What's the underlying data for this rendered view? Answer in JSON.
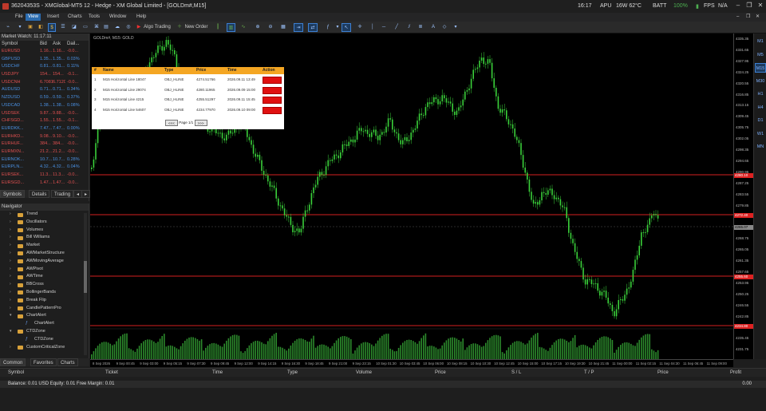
{
  "window": {
    "title": "36204353S - XMGlobal-MT5 12 - Hedge - XM Global Limited - [GOLDm#,M15]",
    "clock": "16:17",
    "cpu_label": "APU",
    "cpu_value": "16W 62°C",
    "batt_label": "BATT",
    "batt_value": "100%",
    "fps_label": "FPS",
    "fps_value": "N/A"
  },
  "menu": [
    "File",
    "View",
    "Insert",
    "Charts",
    "Tools",
    "Window",
    "Help"
  ],
  "toolbar": {
    "algo_label": "Algo Trading",
    "new_order_label": "New Order"
  },
  "market_watch": {
    "title": "Market Watch: 11:17:11",
    "columns": {
      "symbol": "Symbol",
      "bid": "Bid",
      "ask": "Ask",
      "daily": "Dail..."
    },
    "rows": [
      {
        "symbol": "EURUSD",
        "bid": "1.16...",
        "ask": "1.16...",
        "daily": "-0.0...",
        "dir": "neg"
      },
      {
        "symbol": "GBPUSD",
        "bid": "1.35...",
        "ask": "1.35...",
        "daily": "0.03%",
        "dir": "pos"
      },
      {
        "symbol": "USDCHF",
        "bid": "0.81...",
        "ask": "0.81...",
        "daily": "0.11%",
        "dir": "pos"
      },
      {
        "symbol": "USDJPY",
        "bid": "154...",
        "ask": "154...",
        "daily": "-0.1...",
        "dir": "neg"
      },
      {
        "symbol": "USDCNH",
        "bid": "6.7081",
        "ask": "6.7120",
        "daily": "-0.0...",
        "dir": "neg"
      },
      {
        "symbol": "AUDUSD",
        "bid": "0.71...",
        "ask": "0.71...",
        "daily": "0.34%",
        "dir": "pos"
      },
      {
        "symbol": "NZDUSD",
        "bid": "0.59...",
        "ask": "0.59...",
        "daily": "0.37%",
        "dir": "pos"
      },
      {
        "symbol": "USDCAD",
        "bid": "1.38...",
        "ask": "1.38...",
        "daily": "0.08%",
        "dir": "pos"
      },
      {
        "symbol": "USDSEK",
        "bid": "9.87...",
        "ask": "9.88...",
        "daily": "-0.0...",
        "dir": "neg"
      },
      {
        "symbol": "CHFSGD...",
        "bid": "1.55...",
        "ask": "1.55...",
        "daily": "-0.1...",
        "dir": "neg"
      },
      {
        "symbol": "EURDKK...",
        "bid": "7.47...",
        "ask": "7.47...",
        "daily": "0.00%",
        "dir": "pos"
      },
      {
        "symbol": "EURHKD...",
        "bid": "9.08...",
        "ask": "9.10...",
        "daily": "-0.0...",
        "dir": "neg"
      },
      {
        "symbol": "EURHUF...",
        "bid": "384...",
        "ask": "384...",
        "daily": "-0.0...",
        "dir": "neg"
      },
      {
        "symbol": "EURMXN...",
        "bid": "21.2...",
        "ask": "21.2...",
        "daily": "-0.0...",
        "dir": "neg"
      },
      {
        "symbol": "EURNOK...",
        "bid": "10.7...",
        "ask": "10.7...",
        "daily": "0.28%",
        "dir": "pos"
      },
      {
        "symbol": "EURPLN...",
        "bid": "4.32...",
        "ask": "4.32...",
        "daily": "0.04%",
        "dir": "pos"
      },
      {
        "symbol": "EURSEK...",
        "bid": "11.3...",
        "ask": "11.3...",
        "daily": "-0.0...",
        "dir": "neg"
      },
      {
        "symbol": "EURSGD...",
        "bid": "1.47...",
        "ask": "1.47...",
        "daily": "-0.0...",
        "dir": "neg"
      }
    ],
    "tabs": [
      "Symbols",
      "Details",
      "Trading"
    ]
  },
  "navigator": {
    "title": "Navigator",
    "items": [
      {
        "label": "Trend",
        "level": 1,
        "type": "folder",
        "state": "collapsed"
      },
      {
        "label": "Oscillators",
        "level": 1,
        "type": "folder",
        "state": "collapsed"
      },
      {
        "label": "Volumes",
        "level": 1,
        "type": "folder",
        "state": "collapsed"
      },
      {
        "label": "Bill Williams",
        "level": 1,
        "type": "folder",
        "state": "collapsed"
      },
      {
        "label": "Market",
        "level": 1,
        "type": "folder",
        "state": "collapsed"
      },
      {
        "label": "AWMarketStructure",
        "level": 1,
        "type": "folder",
        "state": "collapsed"
      },
      {
        "label": "AWMovingAverage",
        "level": 1,
        "type": "folder",
        "state": "collapsed"
      },
      {
        "label": "AWPivot",
        "level": 1,
        "type": "folder",
        "state": "collapsed"
      },
      {
        "label": "AWTime",
        "level": 1,
        "type": "folder",
        "state": "collapsed"
      },
      {
        "label": "BBCross",
        "level": 1,
        "type": "folder",
        "state": "collapsed"
      },
      {
        "label": "BollingerBands",
        "level": 1,
        "type": "folder",
        "state": "collapsed"
      },
      {
        "label": "Break Flip",
        "level": 1,
        "type": "folder",
        "state": "collapsed"
      },
      {
        "label": "CandlePatternPro",
        "level": 1,
        "type": "folder",
        "state": "collapsed"
      },
      {
        "label": "ChartAlert",
        "level": 1,
        "type": "folder",
        "state": "expanded"
      },
      {
        "label": "ChartAlert",
        "level": 2,
        "type": "indicator",
        "state": ""
      },
      {
        "label": "CTDZone",
        "level": 1,
        "type": "folder",
        "state": "expanded"
      },
      {
        "label": "CTDZone",
        "level": 2,
        "type": "indicator",
        "state": ""
      },
      {
        "label": "CustomCriticalZone",
        "level": 1,
        "type": "folder",
        "state": "collapsed"
      }
    ],
    "tabs": [
      "Common",
      "Favorites",
      "Charts"
    ]
  },
  "chart": {
    "symbol_label": "GOLDm#, M15: GOLD",
    "alert_panel": {
      "columns": {
        "num": "#",
        "name": "Name",
        "type": "Type",
        "price": "Price",
        "time": "Time",
        "action": "Action"
      },
      "rows": [
        {
          "num": "1",
          "name": "M15 Horizontal Line 18047",
          "type": "OBJ_HLINE",
          "price": "4274.51766",
          "time": "2026.09.11 13:49"
        },
        {
          "num": "2",
          "name": "M15 Horizontal Line 29074",
          "type": "OBJ_HLINE",
          "price": "4280.11965",
          "time": "2026.09.09 15:00"
        },
        {
          "num": "3",
          "name": "M15 Horizontal Line 4215",
          "type": "OBJ_HLINE",
          "price": "4255.51297",
          "time": "2026.09.11 15:45"
        },
        {
          "num": "4",
          "name": "M15 Horizontal Line 54607",
          "type": "OBJ_HLINE",
          "price": "4234.77970",
          "time": "2026.09.10 09:00"
        }
      ],
      "pager": {
        "prev": "<<<",
        "text": "Page 1/1",
        "next": ">>>"
      }
    },
    "price_labels": [
      "4335.35",
      "4331.65",
      "4327.95",
      "4324.25",
      "4320.55",
      "4316.85",
      "4313.15",
      "4309.45",
      "4305.75",
      "4302.05",
      "4298.35",
      "4294.65",
      "4290.95",
      "4287.25",
      "4283.55",
      "4279.85",
      "4276.15",
      "4272.45",
      "4268.75",
      "4265.05",
      "4261.35",
      "4257.65",
      "4253.95",
      "4250.25",
      "4246.55",
      "4242.85",
      "4239.15",
      "4235.45",
      "4231.75"
    ],
    "price_tags": [
      {
        "text": "4280.10",
        "color": "red"
      },
      {
        "text": "4272.40",
        "color": "red"
      },
      {
        "text": "4265.07",
        "color": "gray"
      },
      {
        "text": "4255.60",
        "color": "red"
      },
      {
        "text": "4234.80",
        "color": "red"
      }
    ],
    "time_labels": [
      "8 Sep 2026",
      "9 Sep 00:45",
      "9 Sep 03:00",
      "9 Sep 05:15",
      "9 Sep 07:30",
      "9 Sep 09:45",
      "9 Sep 12:00",
      "9 Sep 14:15",
      "9 Sep 16:30",
      "9 Sep 18:45",
      "9 Sep 21:00",
      "9 Sep 23:15",
      "10 Sep 01:30",
      "10 Sep 03:45",
      "10 Sep 06:00",
      "10 Sep 08:15",
      "10 Sep 10:30",
      "10 Sep 12:45",
      "10 Sep 15:00",
      "10 Sep 17:15",
      "10 Sep 19:30",
      "10 Sep 21:45",
      "11 Sep 00:00",
      "11 Sep 02:15",
      "11 Sep 04:30",
      "11 Sep 06:45",
      "11 Sep 09:00"
    ],
    "hline_colors": {
      "line": "#d42020",
      "candle": "#3ad03a",
      "volume": "#2c8a2c"
    }
  },
  "timeframes": [
    "M1",
    "M5",
    "M15",
    "M30",
    "H1",
    "H4",
    "D1",
    "W1",
    "MN"
  ],
  "active_timeframe": "M15",
  "terminal": {
    "columns": [
      "Symbol",
      "Ticket",
      "Time",
      "Type",
      "Volume",
      "Price",
      "S / L",
      "T / P",
      "Price",
      "Profit"
    ],
    "balance_text": "Balance: 0.01 USD  Equity: 0.01  Free Margin: 0.01",
    "profit_total": "0.00"
  }
}
